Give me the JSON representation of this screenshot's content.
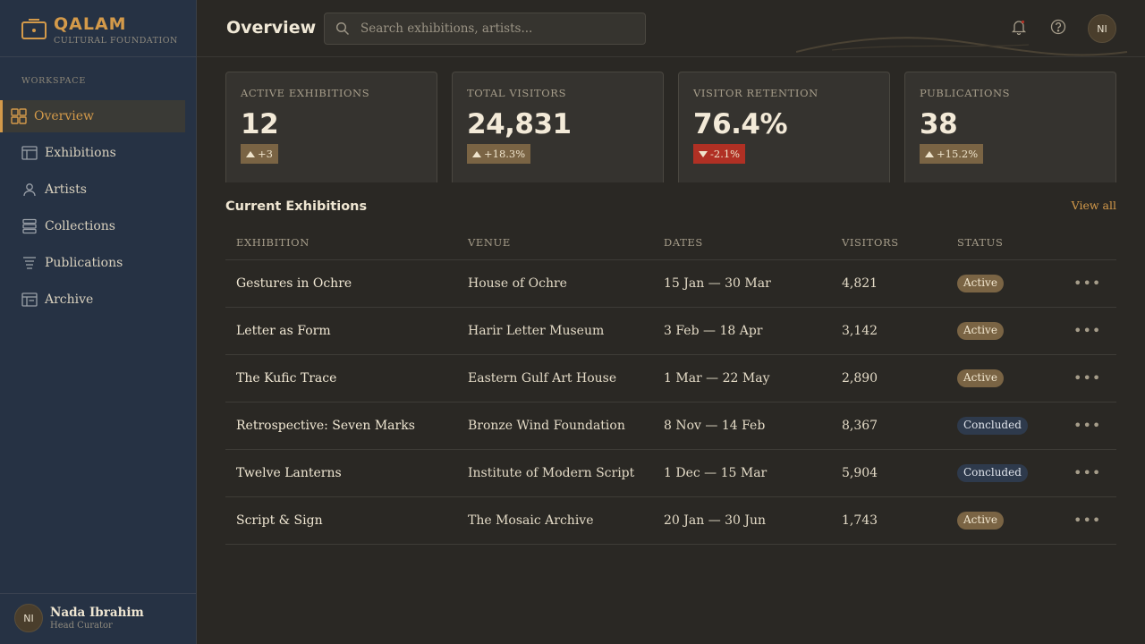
{
  "brand": {
    "name": "QALAM",
    "subtitle": "CULTURAL FOUNDATION"
  },
  "sidebar": {
    "section_label": "WORKSPACE",
    "items": [
      {
        "label": "Overview",
        "icon": "grid-icon",
        "active": true
      },
      {
        "label": "Exhibitions",
        "icon": "layout-icon",
        "active": false
      },
      {
        "label": "Artists",
        "icon": "person-icon",
        "active": false
      },
      {
        "label": "Collections",
        "icon": "stack-icon",
        "active": false
      },
      {
        "label": "Publications",
        "icon": "text-lines-icon",
        "active": false
      },
      {
        "label": "Archive",
        "icon": "archive-icon",
        "active": false
      }
    ],
    "user": {
      "initials": "NI",
      "name": "Nada Ibrahim",
      "role": "Head Curator"
    }
  },
  "header": {
    "title": "Overview",
    "search_placeholder": "Search exhibitions, artists...",
    "avatar_initials": "NI"
  },
  "stats": [
    {
      "label": "ACTIVE EXHIBITIONS",
      "value": "12",
      "delta": "+3",
      "trend": "up"
    },
    {
      "label": "TOTAL VISITORS",
      "value": "24,831",
      "delta": "+18.3%",
      "trend": "up"
    },
    {
      "label": "VISITOR RETENTION",
      "value": "76.4%",
      "delta": "-2.1%",
      "trend": "down"
    },
    {
      "label": "PUBLICATIONS",
      "value": "38",
      "delta": "+15.2%",
      "trend": "up"
    }
  ],
  "exhibitions": {
    "title": "Current Exhibitions",
    "view_all": "View all",
    "columns": [
      "EXHIBITION",
      "VENUE",
      "DATES",
      "VISITORS",
      "STATUS"
    ],
    "rows": [
      {
        "name": "Gestures in Ochre",
        "venue": "House of Ochre",
        "dates": "15 Jan — 30 Mar",
        "visitors": "4,821",
        "status": "Active"
      },
      {
        "name": "Letter as Form",
        "venue": "Harir Letter Museum",
        "dates": "3 Feb — 18 Apr",
        "visitors": "3,142",
        "status": "Active"
      },
      {
        "name": "The Kufic Trace",
        "venue": "Eastern Gulf Art House",
        "dates": "1 Mar — 22 May",
        "visitors": "2,890",
        "status": "Active"
      },
      {
        "name": "Retrospective: Seven Marks",
        "venue": "Bronze Wind Foundation",
        "dates": "8 Nov — 14 Feb",
        "visitors": "8,367",
        "status": "Concluded"
      },
      {
        "name": "Twelve Lanterns",
        "venue": "Institute of Modern Script",
        "dates": "1 Dec — 15 Mar",
        "visitors": "5,904",
        "status": "Concluded"
      },
      {
        "name": "Script & Sign",
        "venue": "The Mosaic Archive",
        "dates": "20 Jan — 30 Jun",
        "visitors": "1,743",
        "status": "Active"
      }
    ]
  },
  "colors": {
    "accent": "#d49a4a",
    "sidebar": "#263244",
    "background": "#2a2824",
    "negative": "#b03024"
  }
}
